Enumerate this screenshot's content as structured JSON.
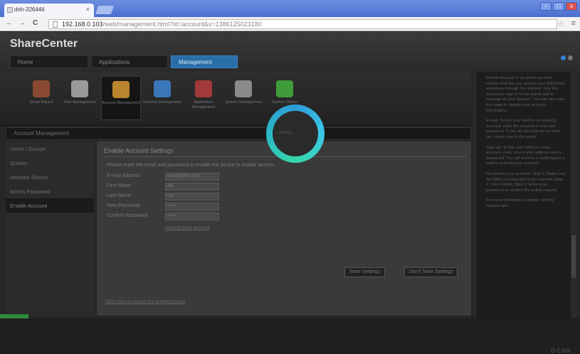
{
  "browser": {
    "tab_title": "dnh-326446",
    "tab_close": "×",
    "back": "←",
    "forward": "→",
    "reload": "C",
    "url_host": "192.168.0.103",
    "url_rest": "/web/management.html?id=account&v=1386125023180",
    "star": "☆",
    "menu": "≡",
    "win_min": "–",
    "win_max": "□",
    "win_close": "x"
  },
  "app": {
    "logo": "ShareCenter",
    "logo_sub": "",
    "user": "",
    "tabs": [
      {
        "label": "Home"
      },
      {
        "label": "Applications"
      },
      {
        "label": "Management"
      }
    ],
    "ribbon": [
      {
        "label": "Setup Wizard",
        "icon": "wizard-icon",
        "color": "#8a4a32"
      },
      {
        "label": "Disk Management",
        "icon": "disk-icon",
        "color": "#9a9a9a"
      },
      {
        "label": "Account Management",
        "icon": "account-icon",
        "color": "#b9852e"
      },
      {
        "label": "Network Management",
        "icon": "network-icon",
        "color": "#3a77b8"
      },
      {
        "label": "Application Management",
        "icon": "application-icon",
        "color": "#a23a3a"
      },
      {
        "label": "System Management",
        "icon": "system-icon",
        "color": "#8a8a8a"
      },
      {
        "label": "System Status",
        "icon": "status-icon",
        "color": "#3f9a3a"
      }
    ],
    "section_header": "Account Management",
    "sidebar": [
      {
        "label": "Users / Groups"
      },
      {
        "label": "Quotas"
      },
      {
        "label": "Network Shares"
      },
      {
        "label": "Admin Password"
      },
      {
        "label": "Enable Account"
      }
    ],
    "content": {
      "title": "Enable Account Settings",
      "description": "Please enter the email and password to enable the device to enable access.",
      "fields": [
        {
          "label": "E-mail Address",
          "value": "user@dlink.com"
        },
        {
          "label": "First Name",
          "value": "dlk"
        },
        {
          "label": "Last Name",
          "value": "link"
        },
        {
          "label": "New Password",
          "value": "•••••"
        },
        {
          "label": "Confirm Password",
          "value": "•••••"
        }
      ],
      "under_link": "Already have account",
      "btn_save": "Save Settings",
      "btn_dont": "Don't Save Settings",
      "footer_link": "Click here to access the enabled portal"
    },
    "loading_label": "Loading..."
  },
  "help": {
    "paragraphs": [
      "Enable Account is an online account service that lets you access your NAS from anywhere through the Internet. Use this account to sign in to the portal and to manage all your devices. You can also use this page to update your account information.",
      "E-mail: To link your NAS to an existing account, enter the account e-mail and password. If you do not have an account yet, create one in the portal.",
      "Sign Up: To link your NAS to a new account, enter your e-mail address and a password. You will receive a confirmation e-mail to activate your account.",
      "To remove your account: Step 1: Make sure the NAS is connected to the Internet. Step 2: Click Unlink. Step 3: Enter your password to confirm the unlink request.",
      "For more information, please visit the support site."
    ],
    "brand": "D-Link"
  }
}
